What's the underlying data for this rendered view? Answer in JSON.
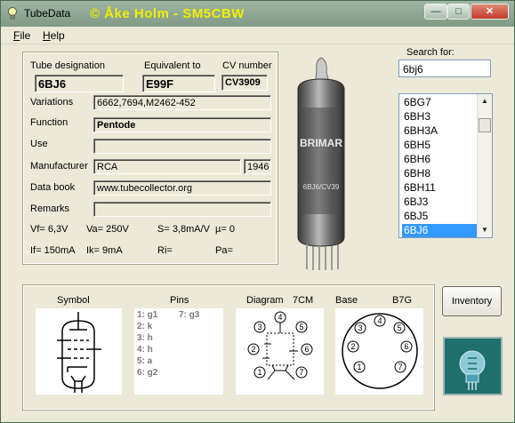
{
  "window": {
    "title": "TubeData",
    "banner": "© Åke Holm - SM5CBW",
    "min_glyph": "—",
    "max_glyph": "□",
    "close_glyph": "✕"
  },
  "menu": {
    "file": "File",
    "help": "Help"
  },
  "form": {
    "tube_designation_label": "Tube designation",
    "tube_designation": "6BJ6",
    "equivalent_label": "Equivalent to",
    "equivalent": "E99F",
    "cv_label": "CV number",
    "cv": "CV3909",
    "variations_label": "Variations",
    "variations": "6662,7694,M2462-452",
    "function_label": "Function",
    "function": "Pentode",
    "use_label": "Use",
    "use": "",
    "manufacturer_label": "Manufacturer",
    "manufacturer": "RCA",
    "year": "1946",
    "databook_label": "Data book",
    "databook": "www.tubecollector.org",
    "remarks_label": "Remarks",
    "remarks": ""
  },
  "specs": {
    "vf": "Vf= 6,3V",
    "va": "Va=  250V",
    "s": "S= 3,8mA/V",
    "mu": "µ=    0",
    "if": "If= 150mA",
    "ik": "Ik=   9mA",
    "ri": "Ri=",
    "pa": "Pa="
  },
  "photo": {
    "print_top": "BRIMAR",
    "print_bottom": "6BJ6/CV39"
  },
  "search": {
    "label": "Search for:",
    "value": "6bj6",
    "items": [
      "6BG7",
      "6BH3",
      "6BH3A",
      "6BH5",
      "6BH6",
      "6BH8",
      "6BH11",
      "6BJ3",
      "6BJ5",
      "6BJ6"
    ],
    "selected": "6BJ6",
    "up_glyph": "▲",
    "down_glyph": "▼"
  },
  "bottom": {
    "symbol_label": "Symbol",
    "pins_label": "Pins",
    "diagram_label": "Diagram",
    "diagram_code": "7CM",
    "base_label": "Base",
    "base_code": "B7G",
    "pins_left": [
      "1: g1",
      "2: k",
      "3: h",
      "4: h",
      "5: a",
      "6: g2"
    ],
    "pins_right": [
      "7: g3"
    ],
    "diagram_pins": [
      "1",
      "2",
      "3",
      "4",
      "5",
      "6",
      "7"
    ],
    "base_pins": [
      "1",
      "2",
      "3",
      "4",
      "5",
      "6",
      "7"
    ]
  },
  "buttons": {
    "inventory": "Inventory"
  },
  "colors": {
    "banner": "#f2ee00",
    "selection": "#3399ff",
    "titlebar": "#8fa994",
    "logo": "#1f6f6e"
  }
}
